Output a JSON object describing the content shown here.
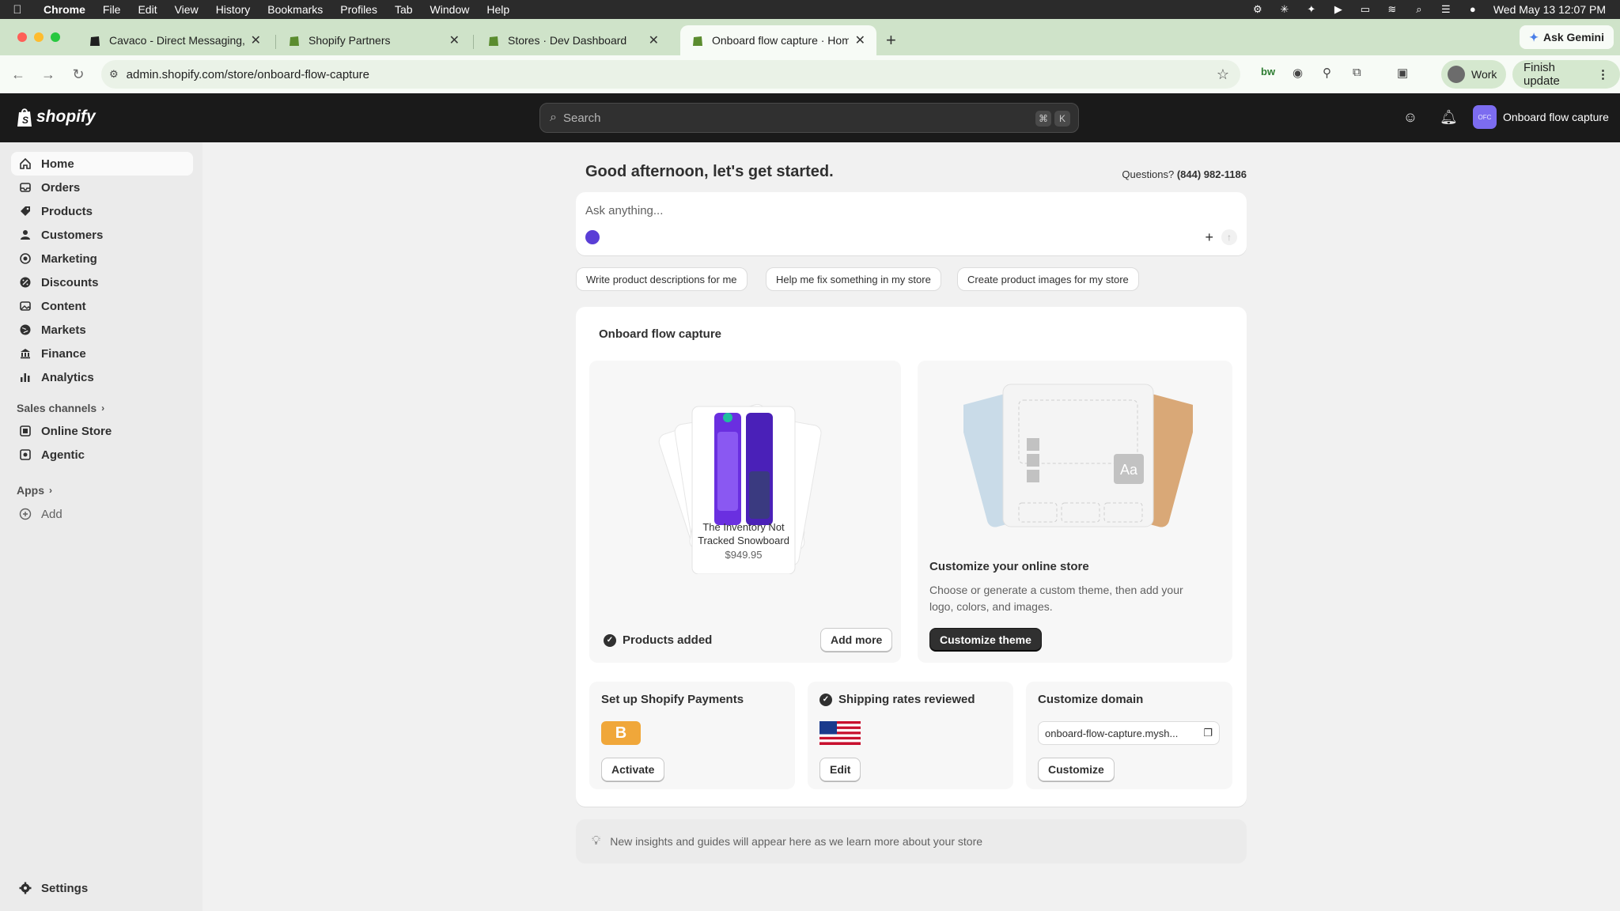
{
  "menubar": {
    "app": "Chrome",
    "items": [
      "File",
      "Edit",
      "View",
      "History",
      "Bookmarks",
      "Profiles",
      "Tab",
      "Window",
      "Help"
    ],
    "clock": "Wed May 13  12:07 PM"
  },
  "tabs": [
    {
      "title": "Cavaco - Direct Messaging, F"
    },
    {
      "title": "Shopify Partners"
    },
    {
      "title": "Stores · Dev Dashboard"
    },
    {
      "title": "Onboard flow capture · Home"
    }
  ],
  "browser": {
    "ask_gemini": "Ask Gemini",
    "url": "admin.shopify.com/store/onboard-flow-capture",
    "profile": "Work",
    "finish_update": "Finish update"
  },
  "shopify": {
    "logo_text": "shopify",
    "search_placeholder": "Search",
    "kbd1": "⌘",
    "kbd2": "K",
    "store_initials": "OFC",
    "store_name": "Onboard flow capture"
  },
  "sidebar": {
    "items": [
      {
        "label": "Home",
        "icon": "home-icon"
      },
      {
        "label": "Orders",
        "icon": "inbox-icon"
      },
      {
        "label": "Products",
        "icon": "tag-icon"
      },
      {
        "label": "Customers",
        "icon": "person-icon"
      },
      {
        "label": "Marketing",
        "icon": "target-icon"
      },
      {
        "label": "Discounts",
        "icon": "discount-icon"
      },
      {
        "label": "Content",
        "icon": "image-icon"
      },
      {
        "label": "Markets",
        "icon": "globe-icon"
      },
      {
        "label": "Finance",
        "icon": "bank-icon"
      },
      {
        "label": "Analytics",
        "icon": "bar-chart-icon"
      }
    ],
    "sales_channels": "Sales channels",
    "channels": [
      {
        "label": "Online Store"
      },
      {
        "label": "Agentic"
      }
    ],
    "apps": "Apps",
    "add": "Add",
    "settings": "Settings"
  },
  "main": {
    "greeting": "Good afternoon, let's get started.",
    "questions_label": "Questions?",
    "phone": "(844) 982-1186",
    "ask_placeholder": "Ask anything...",
    "chips": [
      "Write product descriptions for me",
      "Help me fix something in my store",
      "Create product images for my store"
    ],
    "card_title": "Onboard flow capture",
    "product": {
      "name_line1": "The Inventory Not",
      "name_line2": "Tracked Snowboard",
      "price": "$949.95"
    },
    "products_added": "Products added",
    "add_more": "Add more",
    "theme_placeholder": "Aa",
    "customize_title": "Customize your online store",
    "customize_desc_line1": "Choose or generate a custom theme, then add your",
    "customize_desc_line2": "logo, colors, and images.",
    "customize_theme": "Customize theme",
    "payments_title": "Set up Shopify Payments",
    "payments_badge": "B",
    "activate": "Activate",
    "shipping_title": "Shipping rates reviewed",
    "edit": "Edit",
    "domain_title": "Customize domain",
    "domain_value": "onboard-flow-capture.mysh...",
    "customize": "Customize",
    "insight": "New insights and guides will appear here as we learn more about your store"
  },
  "colors": {
    "accent_purple": "#7c6cf0",
    "payments_badge": "#f0a73a",
    "tab_strip": "#cfe3c9",
    "shopify_bar": "#1a1a1a"
  }
}
